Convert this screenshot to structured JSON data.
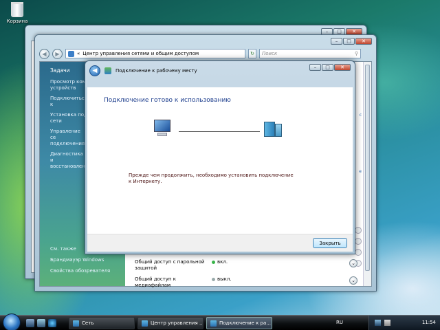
{
  "desktop": {
    "recycle_bin_label": "Корзина"
  },
  "network_center": {
    "address": "Центр управления сетями и общим доступом",
    "search_placeholder": "Поиск",
    "sidebar": {
      "tasks_heading": "Задачи",
      "links": [
        "Просмотр ком устройств",
        "Подключиться к",
        "Установка под сети",
        "Управление се подключения",
        "Диагностика и восстановлени"
      ],
      "see_also": "См. также",
      "firewall": "Брандмауэр Windows",
      "browser_props": "Свойства обозревателя"
    },
    "sharing": [
      {
        "label": "Общий доступ с парольной защитой",
        "status": "вкл."
      },
      {
        "label": "Общий доступ к медиафайлам",
        "status": "выкл."
      }
    ]
  },
  "dialog": {
    "title": "Подключение к рабочему месту",
    "heading": "Подключение готово к использованию",
    "message": "Прежде чем продолжить, необходимо установить подключение к Интернету.",
    "close_label": "Закрыть"
  },
  "taskbar": {
    "buttons": [
      {
        "label": "Сеть"
      },
      {
        "label": "Центр управления ..."
      },
      {
        "label": "Подключение к ра..."
      }
    ],
    "language": "RU",
    "clock": "11:54"
  }
}
